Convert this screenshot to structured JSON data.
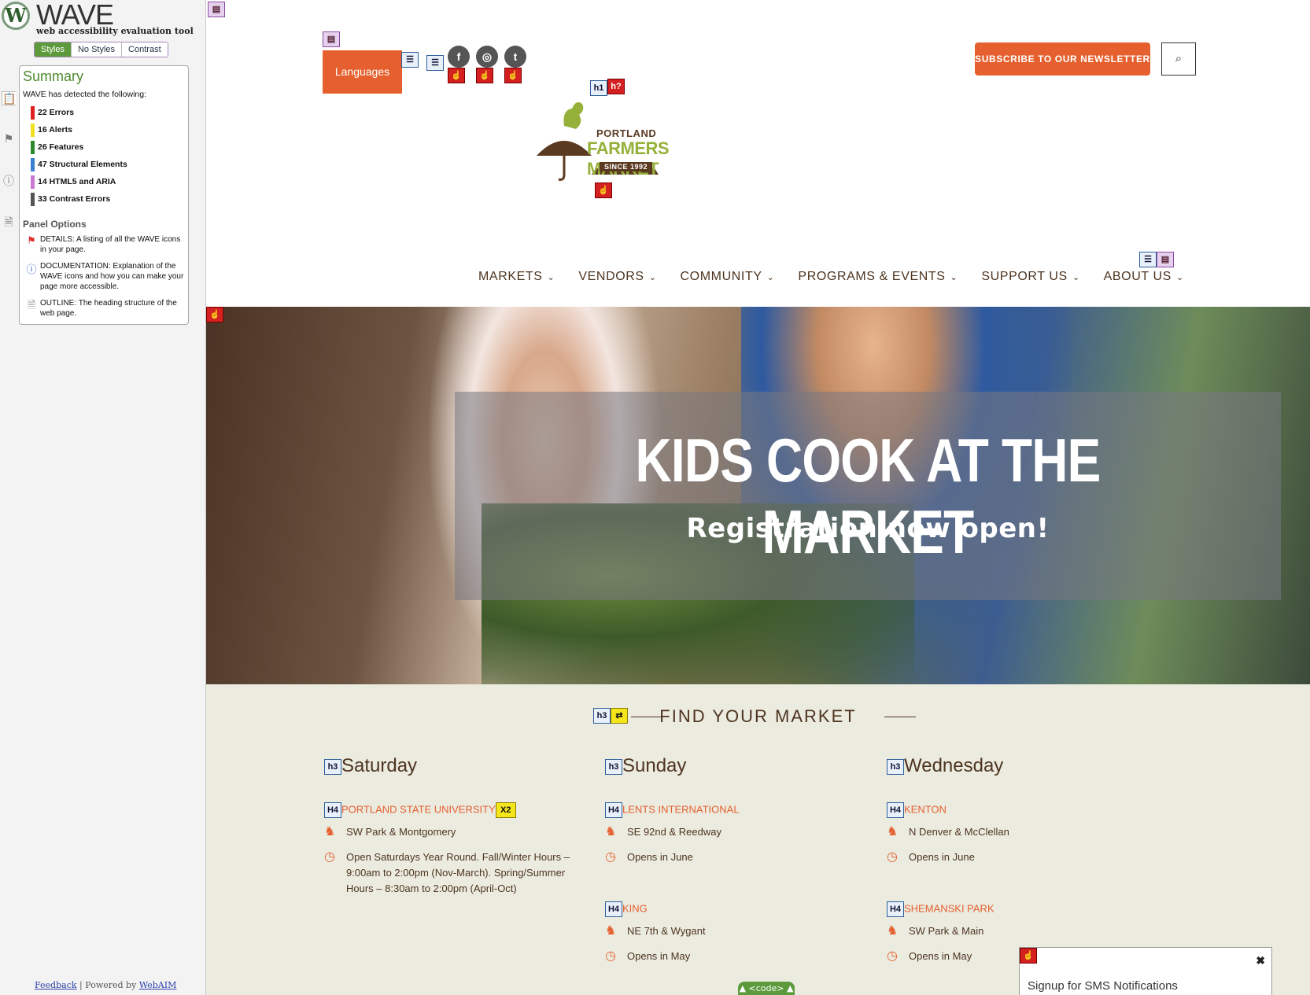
{
  "wave": {
    "logo_letter": "W",
    "title": "WAVE",
    "subtitle": "web accessibility evaluation tool",
    "tabs": [
      "Styles",
      "No Styles",
      "Contrast"
    ],
    "summary_title": "Summary",
    "detected": "WAVE has detected the following:",
    "stats": [
      {
        "label": "22 Errors",
        "color": "#e02020"
      },
      {
        "label": "16 Alerts",
        "color": "#f0e020"
      },
      {
        "label": "26 Features",
        "color": "#2e8a2e"
      },
      {
        "label": "47 Structural Elements",
        "color": "#3b7fd0"
      },
      {
        "label": "14 HTML5 and ARIA",
        "color": "#c87ad0"
      },
      {
        "label": "33 Contrast Errors",
        "color": "#555555"
      }
    ],
    "panel_options_title": "Panel Options",
    "panel_options": [
      {
        "icon": "flag-icon",
        "text": "DETAILS: A listing of all the WAVE icons in your page."
      },
      {
        "icon": "info-icon",
        "text": "DOCUMENTATION: Explanation of the WAVE icons and how you can make your page more accessible."
      },
      {
        "icon": "document-icon",
        "text": "OUTLINE: The heading structure of the web page."
      }
    ],
    "feedback": "Feedback",
    "separator": "|",
    "powered": "Powered by",
    "webaim": "WebAIM"
  },
  "header": {
    "languages": "Languages",
    "social": [
      "f",
      "◎",
      "t"
    ],
    "subscribe": "SUBSCRIBE TO OUR NEWSLETTER",
    "search_icon": "search-icon"
  },
  "logo": {
    "line1": "PORTLAND",
    "line2": "FARMERS MARKET",
    "line3": "SINCE 1992"
  },
  "nav": [
    "MARKETS",
    "VENDORS",
    "COMMUNITY",
    "PROGRAMS & EVENTS",
    "SUPPORT US",
    "ABOUT US"
  ],
  "hero": {
    "title": "KIDS COOK AT THE MARKET",
    "subtitle": "Registration now open!"
  },
  "find_market": "FIND YOUR MARKET",
  "columns": [
    {
      "day": "Saturday",
      "markets": [
        {
          "name": "PORTLAND STATE UNIVERSITY",
          "address": "SW Park & Montgomery",
          "hours": "Open Saturdays Year Round. Fall/Winter Hours – 9:00am to 2:00pm (Nov-March). Spring/Summer Hours – 8:30am to 2:00pm (April-Oct)"
        }
      ]
    },
    {
      "day": "Sunday",
      "markets": [
        {
          "name": "LENTS INTERNATIONAL",
          "address": "SE 92nd & Reedway",
          "hours": "Opens in June"
        },
        {
          "name": "KING",
          "address": "NE 7th & Wygant",
          "hours": "Opens in May"
        }
      ]
    },
    {
      "day": "Wednesday",
      "markets": [
        {
          "name": "KENTON",
          "address": "N Denver & McClellan",
          "hours": "Opens in June"
        },
        {
          "name": "SHEMANSKI PARK",
          "address": "SW Park & Main",
          "hours": "Opens in May"
        }
      ]
    }
  ],
  "wave_markers": {
    "h1": "h1",
    "h2": "h?",
    "h3": "h3",
    "h4": "h4",
    "x2": "x2"
  },
  "sms": {
    "label": "Signup for SMS Notifications",
    "close": "✖"
  },
  "code_tab": "▲ <code> ▲"
}
